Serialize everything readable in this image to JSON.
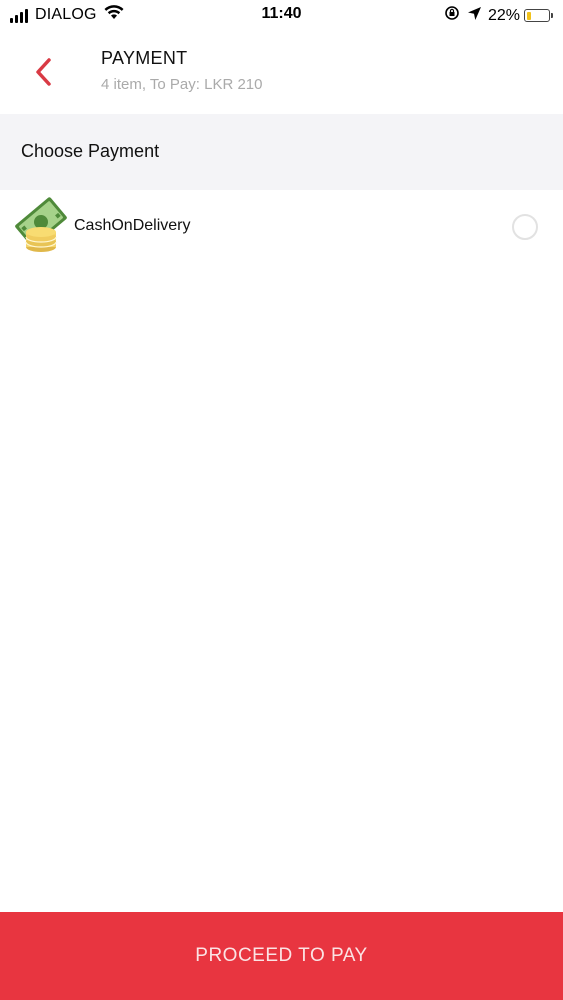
{
  "status_bar": {
    "carrier": "DIALOG",
    "time": "11:40",
    "battery_percent": "22%",
    "battery_level": 0.22
  },
  "header": {
    "title": "PAYMENT",
    "subtitle": "4 item, To Pay: LKR 210"
  },
  "section": {
    "title": "Choose Payment"
  },
  "payment_options": [
    {
      "label": "CashOnDelivery",
      "icon": "cash-coins-icon",
      "selected": false
    }
  ],
  "footer": {
    "proceed_label": "PROCEED TO PAY"
  },
  "colors": {
    "accent": "#e83540",
    "back_arrow": "#d93a44",
    "section_bg": "#f4f4f7",
    "subtitle": "#aaaaaa"
  }
}
